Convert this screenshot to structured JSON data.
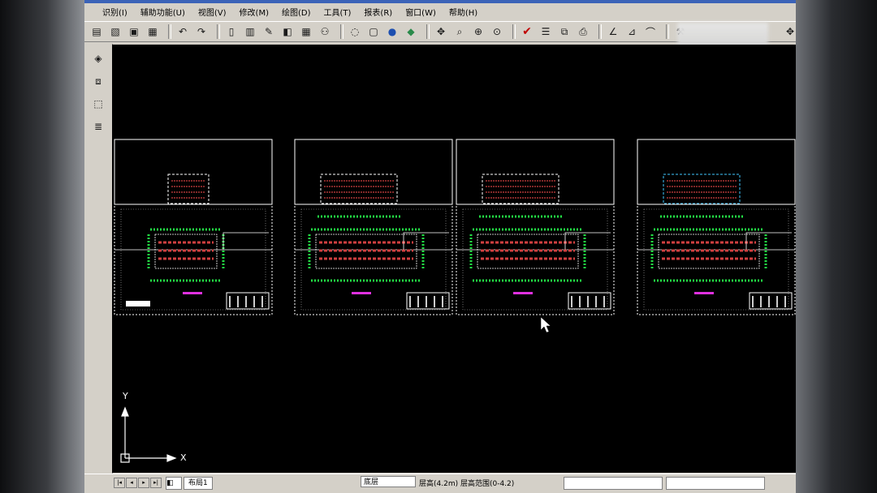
{
  "menu": [
    "识别(I)",
    "辅助功能(U)",
    "视图(V)",
    "修改(M)",
    "绘图(D)",
    "工具(T)",
    "报表(R)",
    "窗口(W)",
    "帮助(H)"
  ],
  "status": {
    "tab_label": "布局1",
    "layer_value": "底层",
    "coordinate_text": "层高(4.2m)  层高范围(0-4.2)"
  },
  "axes": {
    "y_label": "Y",
    "x_label": "X"
  },
  "colors": {
    "canvas": "#000000",
    "ui": "#d4d0c8",
    "drawing_green": "#22dd44",
    "drawing_red": "#d04040",
    "drawing_magenta": "#e030e0",
    "drawing_white": "#ffffff",
    "drawing_cyan": "#40c8ff"
  }
}
